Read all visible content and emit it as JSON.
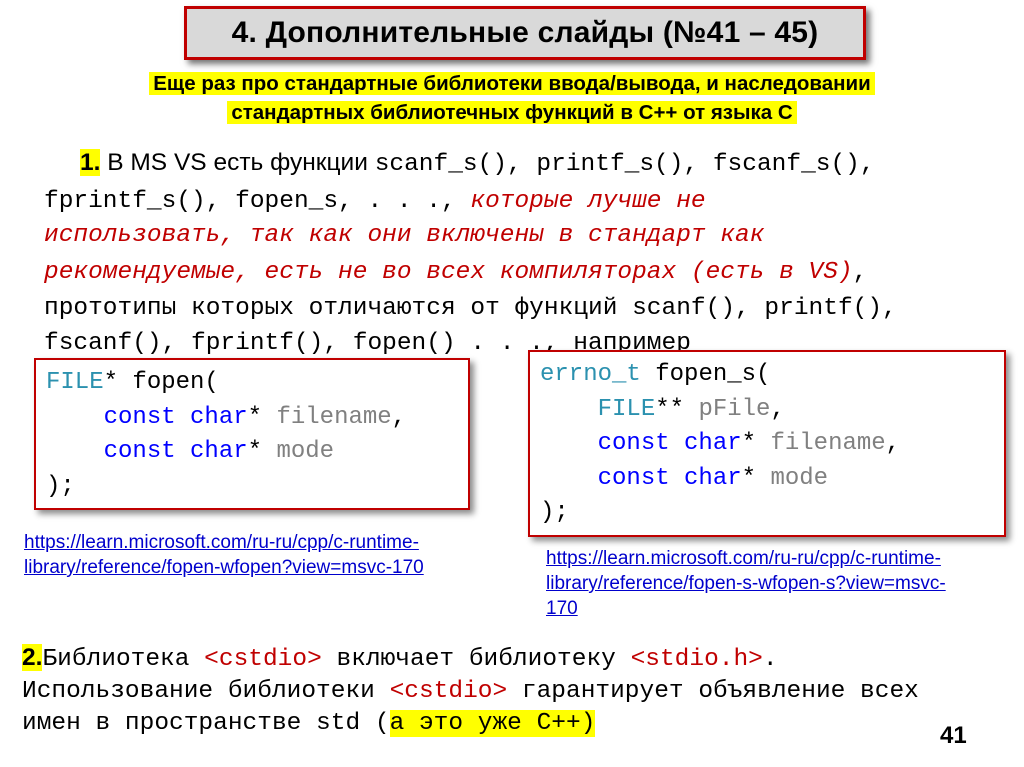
{
  "slide": {
    "title": "4. Дополнительные слайды (№41 – 45)",
    "subtitle_line1": "Еще раз про стандартные библиотеки ввода/вывода,  и наследовании",
    "subtitle_line2": "стандартных библиотечных функций в С++ от языка С",
    "page_number": "41"
  },
  "point1": {
    "number": "1.",
    "intro": " В MS VS есть функции ",
    "funcs_a": "scanf_s(), printf_s(), fscanf_s(),",
    "funcs_b": "fprintf_s(), fopen_s,   . . .,",
    "note_a": " которые лучше не",
    "note_b": "использовать, так как они включены в стандарт как",
    "note_c": "рекомендуемые, есть не во всех компиляторах (есть в VS)",
    "comma": ",",
    "text_b": "прототипы которых отличаются от функций ",
    "funcs_c": "scanf(), printf(),",
    "funcs_d": "fscanf(), fprintf(), fopen() . . ., например"
  },
  "code1": {
    "l1_type": "FILE",
    "l1_rest": "* fopen(",
    "indent": "    ",
    "kw_const": "const",
    "kw_char": "char",
    "star": "* ",
    "p1": "filename",
    "comma": ",",
    "p2": "mode",
    "close": ");"
  },
  "code2": {
    "l1_type": "errno_t",
    "l1_rest": " fopen_s(",
    "indent": "    ",
    "l2_type": "FILE",
    "l2_star": "** ",
    "p0": "pFile",
    "kw_const": "const",
    "kw_char": "char",
    "star": "* ",
    "p1": "filename",
    "comma": ",",
    "p2": "mode",
    "close": ");"
  },
  "links": {
    "link1": "https://learn.microsoft.com/ru-ru/cpp/c-runtime-library/reference/fopen-wfopen?view=msvc-170",
    "link2": "https://learn.microsoft.com/ru-ru/cpp/c-runtime-library/reference/fopen-s-wfopen-s?view=msvc-170"
  },
  "point2": {
    "number": "2.",
    "t1": "Библиотека ",
    "cstdio": "<cstdio>",
    "t2": " включает библиотеку ",
    "stdioh": "<stdio.h>",
    "t3": ".",
    "t4": "Использование библиотеки ",
    "t5": "  гарантирует объявление всех",
    "t6": "имен в пространстве std (",
    "hl": "а это уже С++)"
  },
  "colors": {
    "accent_red": "#c00000",
    "highlight": "#ffff00",
    "keyword": "#0000ff",
    "type": "#2b91af",
    "param": "#808080",
    "link": "#0000cc"
  }
}
